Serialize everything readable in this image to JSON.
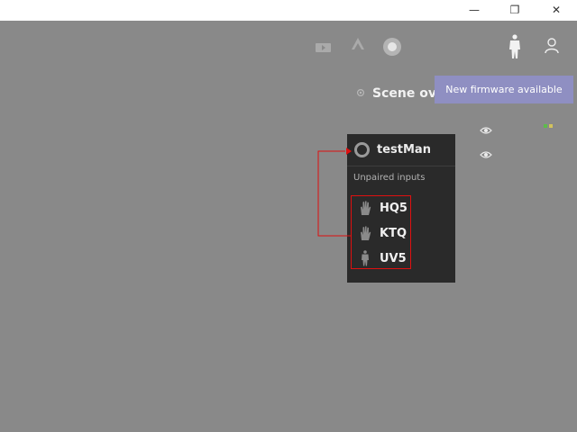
{
  "window_controls": {
    "minimize": "—",
    "restore": "❐",
    "close": "✕"
  },
  "toolbar": {
    "icons": [
      "camera-icon",
      "peak-icon",
      "record-icon",
      "body-icon",
      "user-icon"
    ]
  },
  "scene": {
    "title": "Scene ove",
    "icon": "gear-icon"
  },
  "notification": {
    "text": "New firmware available",
    "color": "#8f8fc2"
  },
  "panel": {
    "actor": {
      "name": "testMan",
      "icon": "actor-ring-icon"
    },
    "unpaired_label": "Unpaired inputs",
    "inputs": [
      {
        "label": "HQ5",
        "icon": "hand-icon"
      },
      {
        "label": "KTQ",
        "icon": "hand-icon"
      },
      {
        "label": "UV5",
        "icon": "body-icon"
      }
    ]
  },
  "colors": {
    "background": "#898989",
    "panel": "#2a2a2a",
    "annotation": "#e01010",
    "status_green": "#5dbb4a",
    "status_yellow": "#d2c35d"
  }
}
